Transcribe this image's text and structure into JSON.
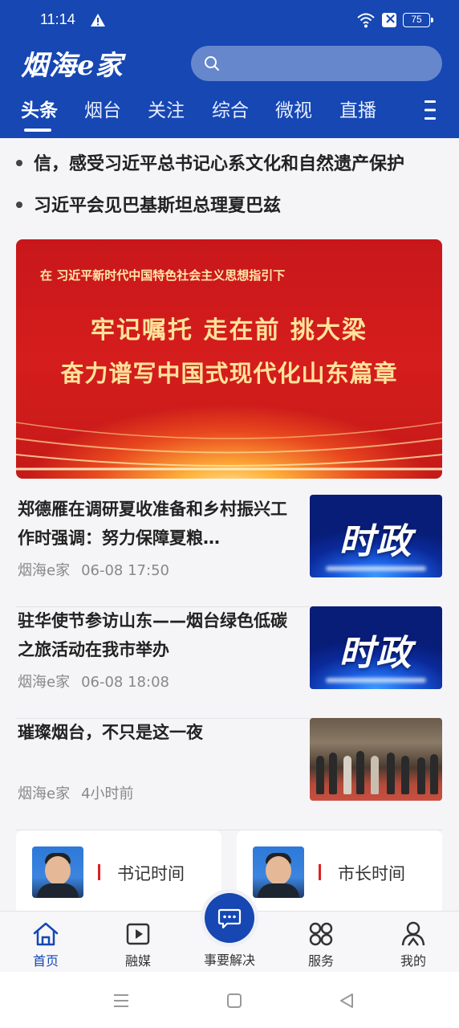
{
  "status_bar": {
    "time": "11:14",
    "battery": "75"
  },
  "header": {
    "logo_text": "烟海e家",
    "tabs": [
      "头条",
      "烟台",
      "关注",
      "综合",
      "微视",
      "直播"
    ],
    "active_tab": "头条"
  },
  "headlines": [
    "信，感受习近平总书记心系文化和自然遗产保护",
    "习近平会见巴基斯坦总理夏巴兹"
  ],
  "banner": {
    "top_line": "在 习近平新时代中国特色社会主义思想指引下",
    "title": "牢记嘱托 走在前 挑大梁",
    "subtitle": "奋力谱写中国式现代化山东篇章"
  },
  "news": [
    {
      "title": "郑德雁在调研夏收准备和乡村振兴工作时强调：努力保障夏粮…",
      "source": "烟海e家",
      "time": "06-08  17:50",
      "thumb_text": "时政"
    },
    {
      "title": "驻华使节参访山东——烟台绿色低碳之旅活动在我市举办",
      "source": "烟海e家",
      "time": "06-08  18:08",
      "thumb_text": "时政"
    },
    {
      "title": "璀璨烟台，不只是这一夜",
      "source": "烟海e家",
      "time": "4小时前",
      "thumb_text": ""
    }
  ],
  "cards": [
    {
      "label": "书记时间"
    },
    {
      "label": "市长时间"
    }
  ],
  "bottom_nav": {
    "items": [
      {
        "label": "首页",
        "icon": "home-icon",
        "active": true
      },
      {
        "label": "融媒",
        "icon": "play-icon",
        "active": false
      },
      {
        "label": "事要解决",
        "icon": "chat-icon",
        "active": false
      },
      {
        "label": "服务",
        "icon": "grid-icon",
        "active": false
      },
      {
        "label": "我的",
        "icon": "user-icon",
        "active": false
      }
    ]
  },
  "colors": {
    "brand": "#1647b3",
    "banner_red": "#c8171b",
    "gold": "#ffe39a"
  }
}
